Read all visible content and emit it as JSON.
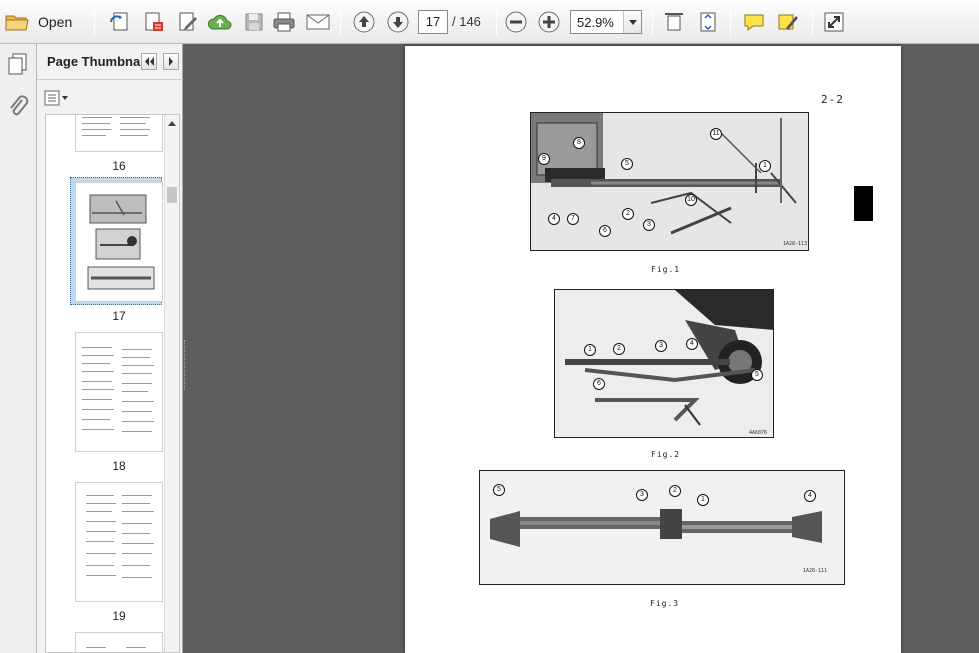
{
  "toolbar": {
    "open_label": "Open",
    "page_current": "17",
    "page_total": "/ 146",
    "zoom_value": "52.9%"
  },
  "panel": {
    "title": "Page Thumbna...",
    "thumbnails": [
      {
        "label": "16"
      },
      {
        "label": "17",
        "selected": true
      },
      {
        "label": "18"
      },
      {
        "label": "19"
      }
    ]
  },
  "document": {
    "page_header": "2-2",
    "figures": [
      {
        "caption": "Fig.1",
        "code": "1A28-113",
        "callouts": [
          "8",
          "9",
          "5",
          "11",
          "1",
          "4",
          "7",
          "6",
          "2",
          "3",
          "10"
        ]
      },
      {
        "caption": "Fig.2",
        "code": "4A6076",
        "callouts": [
          "1",
          "2",
          "3",
          "4",
          "5",
          "6"
        ]
      },
      {
        "caption": "Fig.3",
        "code": "1A28-111",
        "callouts": [
          "5",
          "3",
          "2",
          "1",
          "4"
        ]
      }
    ]
  }
}
